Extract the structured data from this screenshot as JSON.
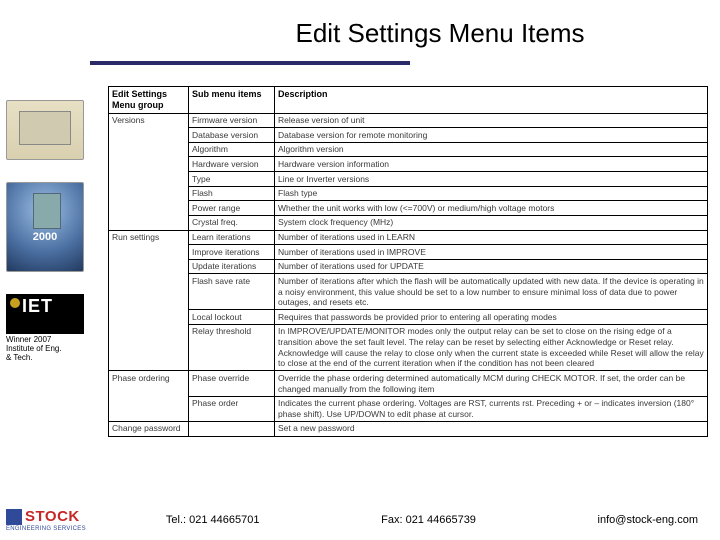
{
  "title": "Edit Settings Menu Items",
  "sidebar": {
    "award_year": "2000",
    "iet": "IET",
    "caption_l1": "Winner 2007",
    "caption_l2": "Institute of Eng.",
    "caption_l3": "& Tech."
  },
  "table": {
    "headers": {
      "group": "Edit Settings Menu group",
      "sub": "Sub menu items",
      "desc": "Description"
    },
    "rows": [
      {
        "group": "Versions",
        "sub": "Firmware version",
        "desc": "Release version of unit"
      },
      {
        "group": "",
        "sub": "Database version",
        "desc": "Database version for remote monitoring"
      },
      {
        "group": "",
        "sub": "Algorithm",
        "desc": "Algorithm version"
      },
      {
        "group": "",
        "sub": "Hardware version",
        "desc": "Hardware version information"
      },
      {
        "group": "",
        "sub": "Type",
        "desc": "Line or Inverter versions"
      },
      {
        "group": "",
        "sub": "Flash",
        "desc": "Flash type"
      },
      {
        "group": "",
        "sub": "Power range",
        "desc": "Whether the unit works with low (<=700V) or medium/high voltage motors"
      },
      {
        "group": "",
        "sub": "Crystal freq.",
        "desc": "System clock frequency (MHz)"
      },
      {
        "group": "Run settings",
        "sub": "Learn iterations",
        "desc": "Number of iterations used in LEARN"
      },
      {
        "group": "",
        "sub": "Improve iterations",
        "desc": "Number of iterations used in IMPROVE"
      },
      {
        "group": "",
        "sub": "Update iterations",
        "desc": "Number of iterations used for UPDATE"
      },
      {
        "group": "",
        "sub": "Flash save rate",
        "desc": "Number of iterations after which the flash will be automatically updated with new data. If the device is operating in a noisy environment, this value should be set to a low number to ensure minimal loss of data due to power outages, and resets etc."
      },
      {
        "group": "",
        "sub": "Local lockout",
        "desc": "Requires that passwords be provided prior to entering all operating modes"
      },
      {
        "group": "",
        "sub": "Relay threshold",
        "desc": "In IMPROVE/UPDATE/MONITOR modes only the output relay can be set to close on the rising edge of a transition above the set fault level. The relay can be reset by selecting either Acknowledge or Reset relay. Acknowledge will cause the relay to close only when the current state is exceeded while Reset will allow the relay to close at the end of the current iteration when if the condition has not been cleared"
      },
      {
        "group": "Phase ordering",
        "sub": "Phase override",
        "desc": "Override the phase ordering determined automatically MCM during CHECK MOTOR. If set, the order can be changed manually from the following item"
      },
      {
        "group": "",
        "sub": "Phase order",
        "desc": "Indicates the current phase ordering. Voltages are RST, currents rst. Preceding + or – indicates inversion (180° phase shift). Use UP/DOWN to edit phase at cursor."
      },
      {
        "group": "Change password",
        "sub": "",
        "desc": "Set a new password"
      }
    ]
  },
  "footer": {
    "brand": "STOCK",
    "brand_sub": "ENGINEERING SERVICES",
    "tel": "Tel.: 021 44665701",
    "fax": "Fax: 021 44665739",
    "email": "info@stock-eng.com"
  }
}
